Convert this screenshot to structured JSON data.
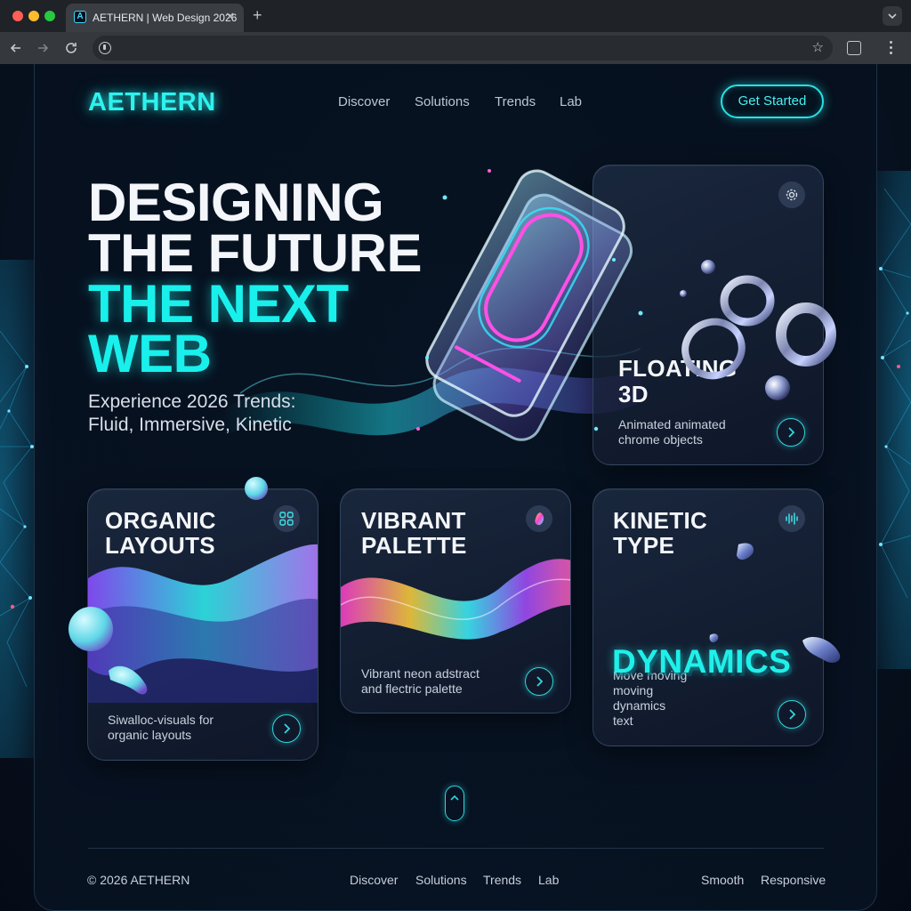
{
  "browser": {
    "tab_title": "AETHERN | Web Design 2026",
    "favicon_letter": "A",
    "tab_close": "✕",
    "new_tab": "+"
  },
  "header": {
    "logo": "AETHERN",
    "nav": [
      "Discover",
      "Solutions",
      "Trends",
      "Lab"
    ],
    "cta": "Get Started"
  },
  "hero": {
    "lines": [
      "DESIGNING",
      "THE FUTURE",
      "THE NEXT",
      "WEB"
    ],
    "subtitle_lines": [
      "Experience 2026 Trends:",
      "Fluid, Immersive, Kinetic"
    ]
  },
  "cards": {
    "floating": {
      "title_lines": [
        "FLOATING",
        "3D"
      ],
      "desc_lines": [
        "Animated animated",
        "chrome objects"
      ],
      "icon": "gear-icon"
    },
    "organic": {
      "title_lines": [
        "ORGANIC",
        "LAYOUTS"
      ],
      "desc_lines": [
        "Siwalloc-visuals for",
        "organic layouts"
      ],
      "icon": "grid-icon"
    },
    "vibrant": {
      "title_lines": [
        "VIBRANT",
        "PALETTE"
      ],
      "desc_lines": [
        "Vibrant neon adstract",
        "and flectric palette"
      ],
      "icon": "palette-icon"
    },
    "kinetic": {
      "title_lines": [
        "KINETIC",
        "TYPE"
      ],
      "highlight": "DYNAMICS",
      "desc_lines": [
        "Move moving",
        "moving",
        "dynamics",
        "text"
      ],
      "icon": "audio-wave-icon"
    }
  },
  "footer": {
    "copyright": "© 2026 AETHERN",
    "nav": [
      "Discover",
      "Solutions",
      "Trends",
      "Lab"
    ],
    "tags": [
      "Smooth",
      "Responsive"
    ]
  },
  "colors": {
    "accent_cyan": "#19f0ec",
    "background": "#050b16",
    "card_border": "#2fd8de"
  }
}
